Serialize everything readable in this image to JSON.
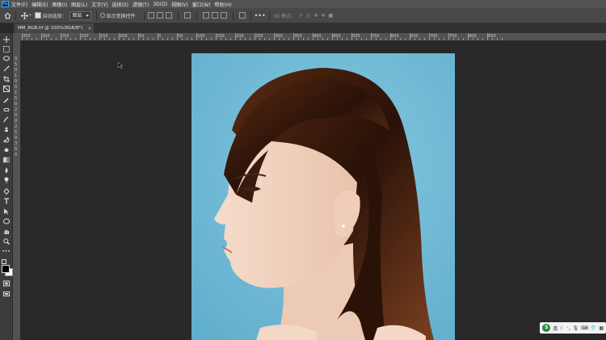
{
  "app": {
    "logo_text": "Ps"
  },
  "menubar": {
    "items": [
      "文件(F)",
      "编辑(E)",
      "图像(I)",
      "图层(L)",
      "文字(Y)",
      "选择(S)",
      "滤镜(T)",
      "3D(D)",
      "视图(V)",
      "窗口(W)",
      "帮助(H)"
    ]
  },
  "options": {
    "auto_select_label": "自动选择：",
    "auto_select_value": "图层",
    "show_transform_label": "显示变换控件",
    "mode_label": "3D 模式："
  },
  "tab": {
    "title": "MM_RGB.tif @ 100%(RGB/8*)",
    "close": "×"
  },
  "ruler_h": [
    "350",
    "300",
    "250",
    "200",
    "150",
    "100",
    "50",
    "0",
    "50",
    "100",
    "150",
    "200",
    "250",
    "300",
    "350",
    "400",
    "450",
    "500",
    "550",
    "600",
    "650",
    "700",
    "750",
    "800",
    "850"
  ],
  "ruler_v": [
    "0",
    "5",
    "0",
    "1",
    "0",
    "0",
    "1",
    "5",
    "0",
    "2",
    "0",
    "0",
    "2",
    "5",
    "0",
    "3",
    "0",
    "0"
  ],
  "taskbar": {
    "ime_label": "英",
    "logo": "S"
  },
  "colors": {
    "photo_background": "#7bc1da",
    "ui_dark": "#282828",
    "ui_panel": "#535353"
  }
}
